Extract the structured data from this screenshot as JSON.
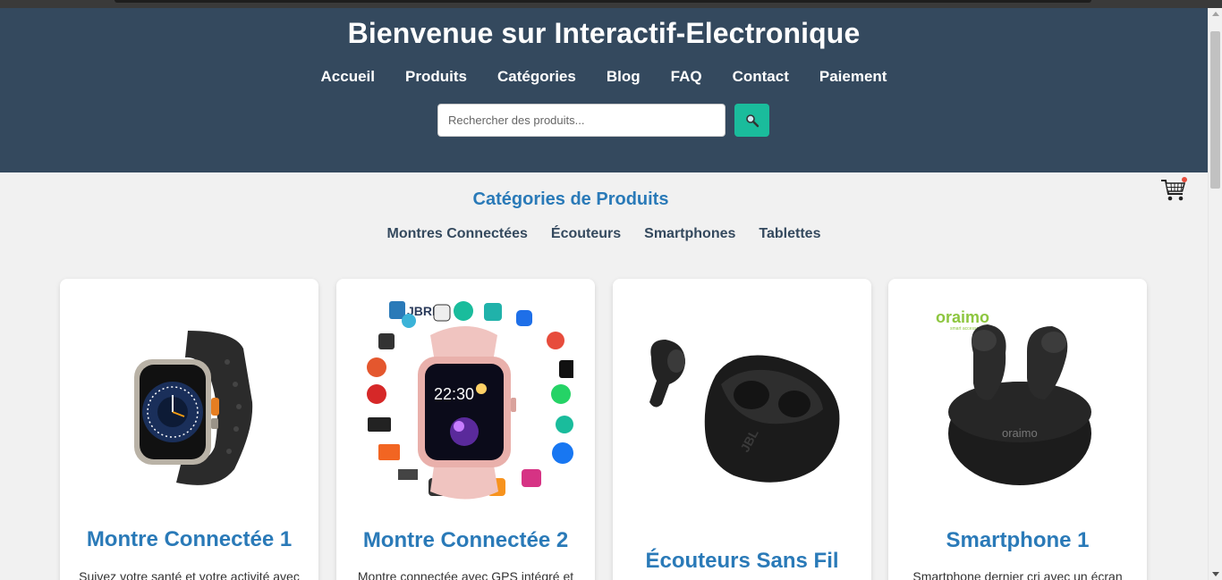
{
  "header": {
    "title": "Bienvenue sur Interactif-Electronique",
    "nav": [
      "Accueil",
      "Produits",
      "Catégories",
      "Blog",
      "FAQ",
      "Contact",
      "Paiement"
    ],
    "search_placeholder": "Rechercher des produits..."
  },
  "categories": {
    "title": "Catégories de Produits",
    "items": [
      "Montres Connectées",
      "Écouteurs",
      "Smartphones",
      "Tablettes"
    ]
  },
  "products": [
    {
      "name": "Montre Connectée 1",
      "description": "Suivez votre santé et votre activité avec"
    },
    {
      "name": "Montre Connectée 2",
      "description": "Montre connectée avec GPS intégré et",
      "image_text": {
        "brand": "JBRL",
        "time": "22:30"
      }
    },
    {
      "name": "Écouteurs Sans Fil",
      "description": "",
      "image_text": {
        "brand": "JBL"
      }
    },
    {
      "name": "Smartphone 1",
      "description": "Smartphone dernier cri avec un écran",
      "image_text": {
        "brand": "oraimo",
        "tagline": "smart accessories",
        "case_brand": "oraimo"
      }
    }
  ],
  "colors": {
    "header": "#34495e",
    "accent": "#1abc9c",
    "title_blue": "#2a7ab8"
  }
}
